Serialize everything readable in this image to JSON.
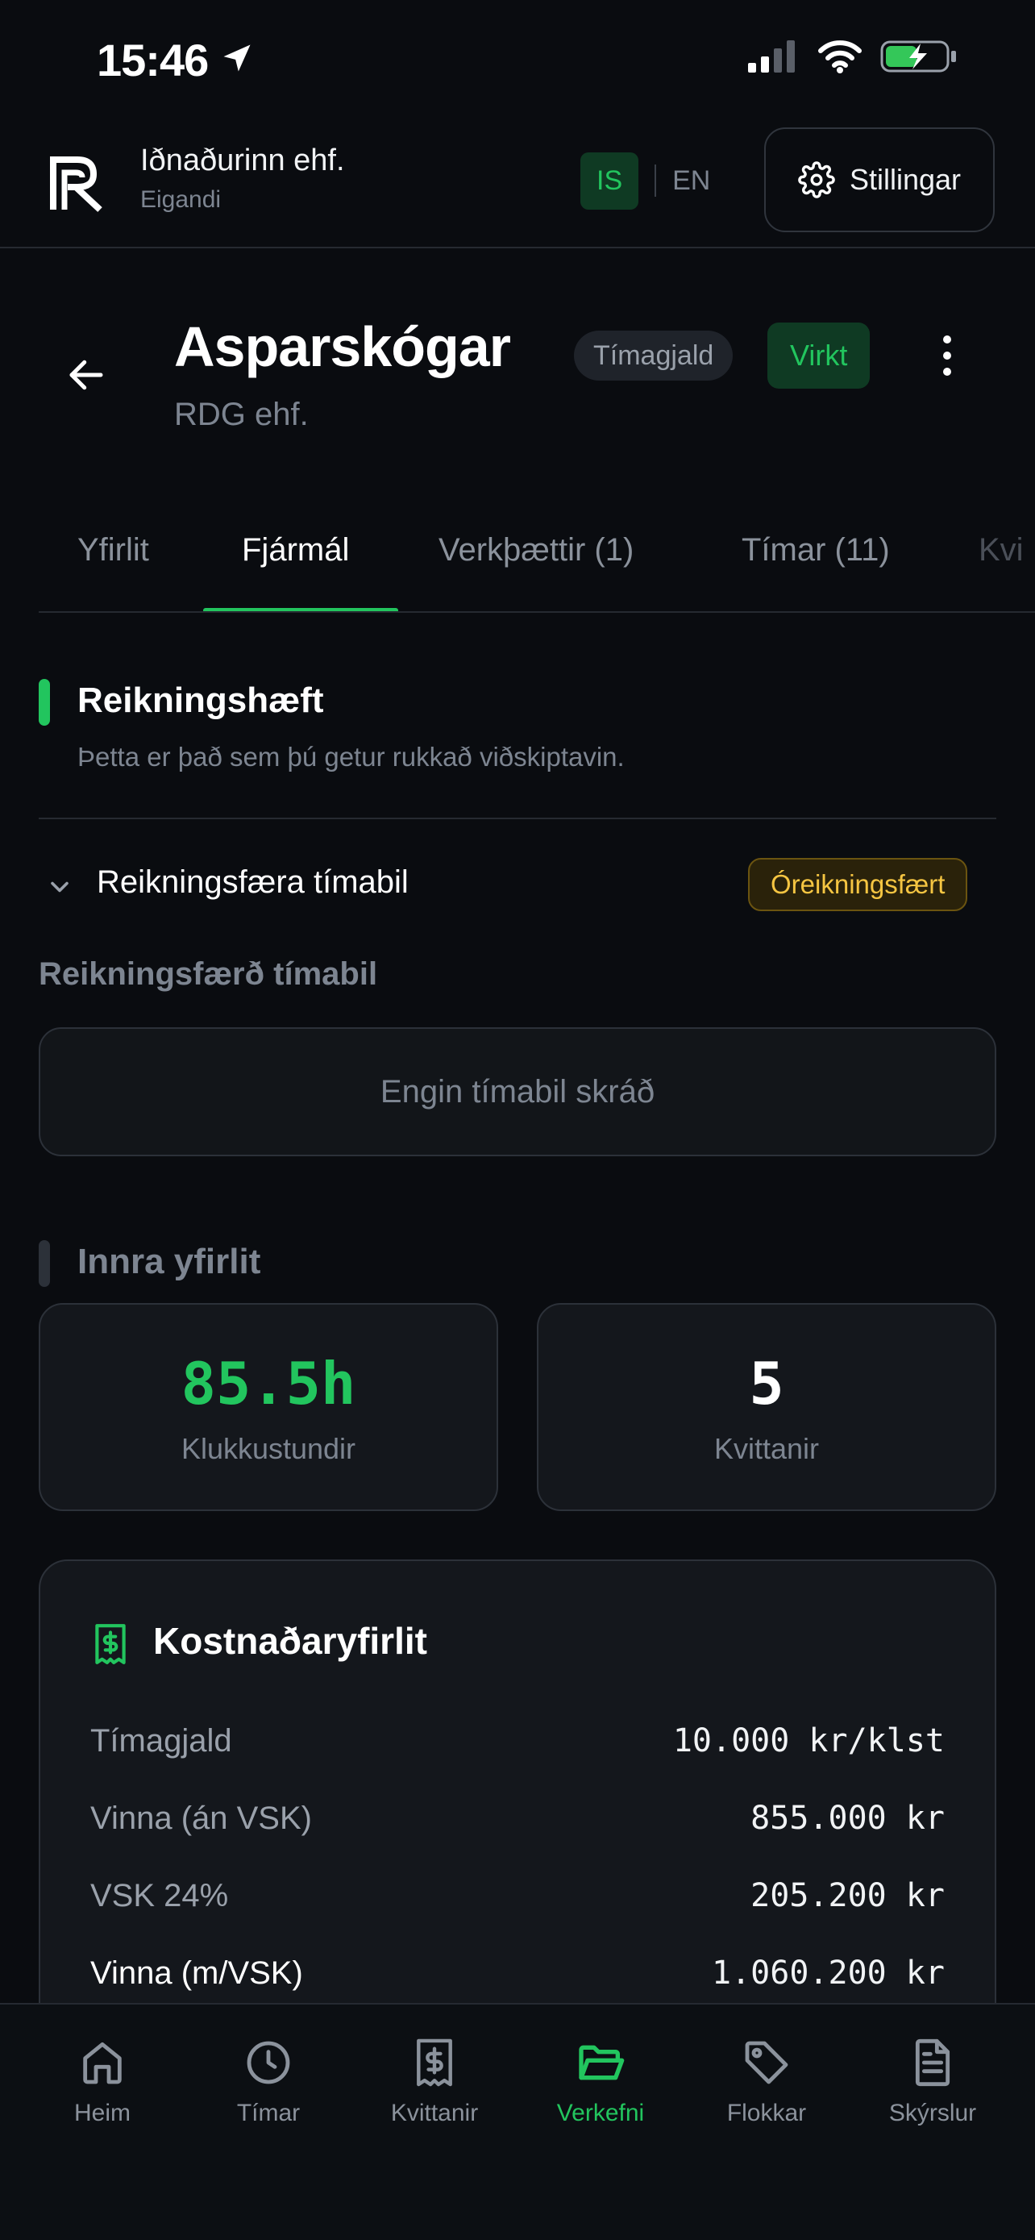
{
  "status_bar": {
    "time": "15:46"
  },
  "header": {
    "company_name": "Iðnaðurinn ehf.",
    "company_role": "Eigandi",
    "lang_is": "IS",
    "lang_en": "EN",
    "settings_label": "Stillingar"
  },
  "project": {
    "title": "Asparskógar",
    "client": "RDG ehf.",
    "billing_tag": "Tímagjald",
    "status_tag": "Virkt"
  },
  "tabs": [
    {
      "label": "Yfirlit"
    },
    {
      "label": "Fjármál"
    },
    {
      "label": "Verkþættir (1)"
    },
    {
      "label": "Tímar (11)"
    },
    {
      "label": "Kvi"
    }
  ],
  "billable": {
    "title": "Reikningshæft",
    "description": "Þetta er það sem þú getur rukkað viðskiptavin.",
    "period_title": "Reikningsfæra tímabil",
    "unbilled_badge": "Óreikningsfært",
    "periods_label": "Reikningsfærð tímabil",
    "empty_text": "Engin tímabil skráð"
  },
  "internal": {
    "title": "Innra yfirlit",
    "hours_value": "85.5h",
    "hours_label": "Klukkustundir",
    "receipts_value": "5",
    "receipts_label": "Kvittanir"
  },
  "cost": {
    "title": "Kostnaðaryfirlit",
    "rows": [
      {
        "label": "Tímagjald",
        "value": "10.000 kr/klst"
      },
      {
        "label": "Vinna (án VSK)",
        "value": "855.000 kr"
      },
      {
        "label": "VSK 24%",
        "value": "205.200 kr"
      },
      {
        "label": "Vinna (m/VSK)",
        "value": "1.060.200 kr"
      }
    ]
  },
  "bottom_nav": [
    {
      "label": "Heim",
      "icon": "home-icon"
    },
    {
      "label": "Tímar",
      "icon": "clock-icon"
    },
    {
      "label": "Kvittanir",
      "icon": "receipt-icon"
    },
    {
      "label": "Verkefni",
      "icon": "folder-icon",
      "active": true
    },
    {
      "label": "Flokkar",
      "icon": "tag-icon"
    },
    {
      "label": "Skýrslur",
      "icon": "document-icon"
    }
  ],
  "colors": {
    "accent": "#22c55e",
    "warning": "#f5c542",
    "background": "#0a0c10",
    "card": "#14171c"
  }
}
